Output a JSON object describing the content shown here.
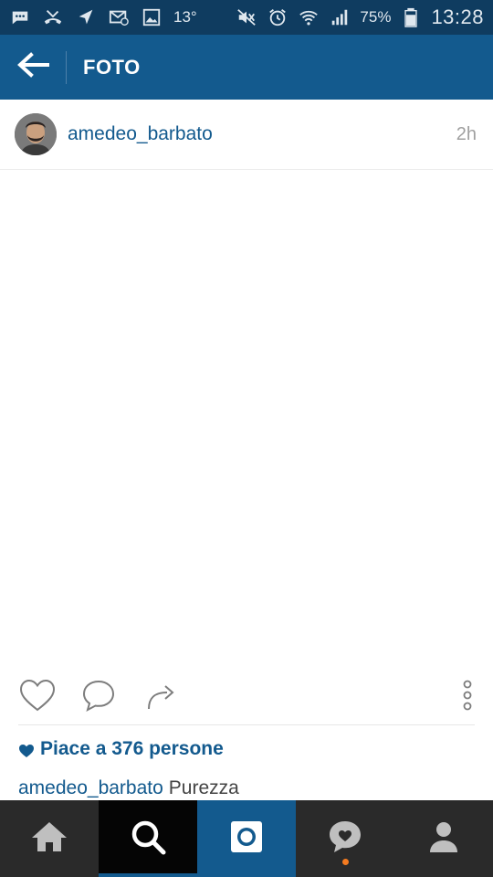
{
  "status_bar": {
    "temperature": "13°",
    "battery_percent": "75%",
    "time": "13:28",
    "left_icons": [
      "chat-icon",
      "missed-call-icon",
      "navigation-icon",
      "email-icon",
      "gallery-icon"
    ],
    "right_icons": [
      "mute-icon",
      "alarm-icon",
      "wifi-icon",
      "signal-icon",
      "battery-icon"
    ]
  },
  "app_bar": {
    "title": "FOTO",
    "back_icon": "back-arrow-icon"
  },
  "post": {
    "username": "amedeo_barbato",
    "time": "2h",
    "likes_text": "Piace a 376 persone",
    "caption_user": "amedeo_barbato",
    "caption_text": "Purezza"
  },
  "actions": [
    "like-icon",
    "comment-icon",
    "share-icon",
    "more-options-icon"
  ],
  "bottom_nav": {
    "items": [
      "home-icon",
      "search-icon",
      "camera-icon",
      "activity-icon",
      "profile-icon"
    ],
    "active": "search",
    "notification_dot_color": "#f47b20"
  },
  "colors": {
    "status_bar": "#0f3c60",
    "app_bar": "#135a8e",
    "link_blue": "#135a8e",
    "nav_background": "#2a2a2a"
  }
}
